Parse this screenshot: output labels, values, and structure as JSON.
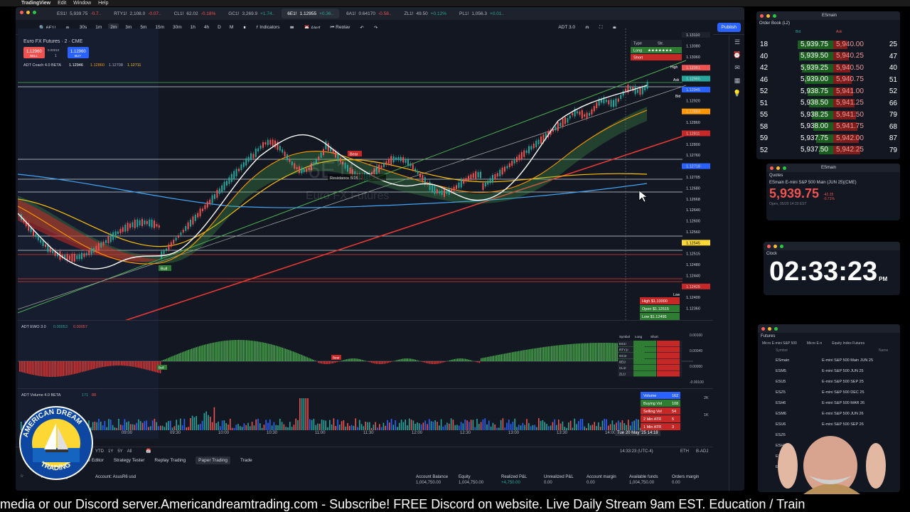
{
  "menubar": {
    "apple": "",
    "app": "TradingView",
    "items": [
      "Edit",
      "Window",
      "Help"
    ]
  },
  "tabs": [
    {
      "symbol": "ES1!",
      "price": "5,939.75",
      "change": "-0.7..",
      "dir": "dn"
    },
    {
      "symbol": "RTY1!",
      "price": "2,108.0",
      "change": "-0.07..",
      "dir": "dn"
    },
    {
      "symbol": "CL1!",
      "price": "62.02",
      "change": "-0.18%",
      "dir": "dn"
    },
    {
      "symbol": "GC1!",
      "price": "3,269.9",
      "change": "+1.74..",
      "dir": "up"
    },
    {
      "symbol": "6E1!",
      "price": "1.12955",
      "change": "+0.36..",
      "dir": "up"
    },
    {
      "symbol": "6A1!",
      "price": "0.64170",
      "change": "-0.58..",
      "dir": "dn"
    },
    {
      "symbol": "ZL1!",
      "price": "49.50",
      "change": "+0.12%",
      "dir": "up"
    },
    {
      "symbol": "PL1!",
      "price": "1,056.3",
      "change": "+0.01..",
      "dir": "up"
    }
  ],
  "toolbar": {
    "symbol": "6E1!",
    "intervals": [
      "30s",
      "1m",
      "2m",
      "3m",
      "5m",
      "15m",
      "30m",
      "1h",
      "4h",
      "D",
      "M"
    ],
    "active_interval": "2m",
    "indicators": "Indicators",
    "alert": "Alert",
    "replay": "Replay",
    "layout_name": "ADT 3.0",
    "layout_sub": "Save",
    "publish": "Publish"
  },
  "chart": {
    "instrument": "Euro FX Futures · 2 · CME",
    "sell_price": "1.12960",
    "sell_label": "SELL",
    "spread": "0.00010",
    "qty": "1",
    "buy_price": "1.12960",
    "buy_label": "BUY",
    "coach_label": "ADT Coach 4.0 BETA",
    "coach_vals": [
      "1.12946",
      "1.12860",
      "1.12708",
      "1.12711"
    ],
    "watermark_symbol": "6E1!, 2",
    "watermark_name": "Euro FX Futures",
    "price_labels": [
      "1.13110",
      "1.13080",
      "1.13060",
      "1.12961",
      "1.12965",
      "1.12945",
      "1.12920",
      "1.12884",
      "1.12860",
      "1.12811",
      "1.12800",
      "1.12760",
      "1.12718",
      "1.12705",
      "1.12680",
      "1.12668",
      "1.12640",
      "1.12600",
      "1.12560",
      "1.12545",
      "1.12515",
      "1.12480",
      "1.12440",
      "1.12425",
      "1.12400",
      "1.12360"
    ],
    "high_marker": "High",
    "ask_marker": "Ask",
    "bid_marker": "Bid",
    "low_marker": "Low",
    "signal_bear": "Bear",
    "signal_bull": "Bull",
    "resistance_label": "Resistance 5/15 ...",
    "stats_box": {
      "high": "High $1.13000",
      "open": "Open $1.12515",
      "low": "Low $1.12495"
    },
    "table_header": {
      "type": "Type",
      "strength": "Str."
    },
    "table_long": "Long",
    "table_short": "Short"
  },
  "ewo": {
    "label": "ADT EWO 3.0",
    "val1": "0.00053",
    "val2": "0.00057",
    "axis": [
      "0.00100",
      "0.00049",
      "0.00000",
      "-0.00100"
    ],
    "table_header": [
      "Symbol",
      "Long",
      "Short"
    ],
    "table_symbols": [
      "ES1!",
      "RTY1!",
      "GC1!",
      "6E1!",
      "CL1!",
      "ZL1!"
    ],
    "signal_bull": "Bull",
    "signal_bear": "Bear"
  },
  "volume": {
    "label": "ADT Volume 4.0 BETA",
    "vals": [
      "171",
      "88"
    ],
    "axis": [
      "2K",
      "1K"
    ],
    "legend": [
      {
        "label": "Volume",
        "val": "162"
      },
      {
        "label": "Buying Vol",
        "val": "108"
      },
      {
        "label": "Selling Vol",
        "val": "54"
      },
      {
        "label": "2 Min ATR",
        "val": "5"
      },
      {
        "label": "1 Min ATR",
        "val": "3"
      }
    ]
  },
  "time_axis": [
    "09:00",
    "09:30",
    "10:00",
    "10:30",
    "11:00",
    "11:30",
    "12:00",
    "12:30",
    "13:00",
    "13:30",
    "14:00"
  ],
  "crosshair_time": "Tue 20 May '25  14:18",
  "bottom": {
    "ranges": [
      "YTD",
      "1Y",
      "5Y",
      "All"
    ],
    "clock": "14:33:23 (UTC-4)",
    "session": "ETH",
    "adj": "B-ADJ"
  },
  "panels": [
    "Pine Editor",
    "Strategy Tester",
    "Replay Trading",
    "Paper Trading",
    "Trade"
  ],
  "active_panel": "Paper Trading",
  "account": {
    "broker": "Paper Trading",
    "account": "Account: AsusR6 usd",
    "stats": [
      {
        "label": "Account Balance",
        "val": "1,004,750.00",
        "up": false
      },
      {
        "label": "Equity",
        "val": "1,004,750.00",
        "up": false
      },
      {
        "label": "Realized P&L",
        "val": "+4,750.00",
        "up": true
      },
      {
        "label": "Unrealized P&L",
        "val": "0.00",
        "up": false
      },
      {
        "label": "Account margin",
        "val": "0.00",
        "up": false
      },
      {
        "label": "Available funds",
        "val": "1,004,750.00",
        "up": false
      },
      {
        "label": "Orders margin",
        "val": "0.00",
        "up": false
      }
    ]
  },
  "orderbook": {
    "window_title": "ESmain",
    "title": "Order Book (L2)",
    "bid_header": "Bid",
    "ask_header": "Ask",
    "rows": [
      {
        "left": "18",
        "bid": "5,939.75",
        "ask": "5,940.00",
        "right": "25"
      },
      {
        "left": "40",
        "bid": "5,939.50",
        "ask": "5,940.25",
        "right": "47"
      },
      {
        "left": "42",
        "bid": "5,939.25",
        "ask": "5,940.50",
        "right": "40"
      },
      {
        "left": "46",
        "bid": "5,939.00",
        "ask": "5,940.75",
        "right": "51"
      },
      {
        "left": "52",
        "bid": "5,938.75",
        "ask": "5,941.00",
        "right": "52"
      },
      {
        "left": "51",
        "bid": "5,938.50",
        "ask": "5,941.25",
        "right": "66"
      },
      {
        "left": "55",
        "bid": "5,938.25",
        "ask": "5,941.50",
        "right": "79"
      },
      {
        "left": "58",
        "bid": "5,938.00",
        "ask": "5,941.75",
        "right": "68"
      },
      {
        "left": "59",
        "bid": "5,937.75",
        "ask": "5,942.00",
        "right": "87"
      },
      {
        "left": "52",
        "bid": "5,937.50",
        "ask": "5,942.25",
        "right": "79"
      }
    ]
  },
  "quotes": {
    "window_title": "ESmain",
    "title": "Quotes",
    "symbol": "ESmain",
    "name": "E-mini S&P 500 Main (JUN 25)(CME)",
    "price": "5,939.75",
    "change": "-42.25 -0.71%",
    "open": "Open, 05/20 14:33 EST"
  },
  "clock": {
    "title": "Clock",
    "time": "02:33:23",
    "ampm": "PM"
  },
  "futures": {
    "title": "Futures",
    "filters": [
      "Micro E-mini S&P 500",
      "Micro E-n",
      "Equity Index Futures"
    ],
    "headers": [
      "Symbol",
      "Name"
    ],
    "rows": [
      {
        "sym": "ESmain",
        "name": "E-mini S&P 500 Main JUN 25"
      },
      {
        "sym": "ESM5",
        "name": "E-mini S&P 500 JUN 25"
      },
      {
        "sym": "ESU5",
        "name": "E-mini S&P 500 SEP 25"
      },
      {
        "sym": "ESZ5",
        "name": "E-mini S&P 500 DEC 25"
      },
      {
        "sym": "ESH6",
        "name": "E-mini S&P 500 MAR 26"
      },
      {
        "sym": "ESM6",
        "name": "E-mini S&P 500 JUN 26"
      },
      {
        "sym": "ESU6",
        "name": "E-mini S&P 500 SEP 26"
      },
      {
        "sym": "ESZ6",
        "name": ""
      },
      {
        "sym": "ESH7",
        "name": ""
      },
      {
        "sym": "ESM7",
        "name": ""
      },
      {
        "sym": "ESU7",
        "name": ""
      }
    ]
  },
  "logo": {
    "top": "AMERICAN DREAM",
    "bottom": "TRADING"
  },
  "banner": "media or our Discord server.Americandreamtrading.com - Subscribe! FREE Discord on website. Live Daily Stream 9am EST. Education / Train",
  "colors": {
    "bg": "#131722",
    "up": "#26a69a",
    "down": "#ef5350",
    "accent": "#2962ff",
    "trend_green": "#4caf50",
    "trend_red": "#e53935"
  }
}
